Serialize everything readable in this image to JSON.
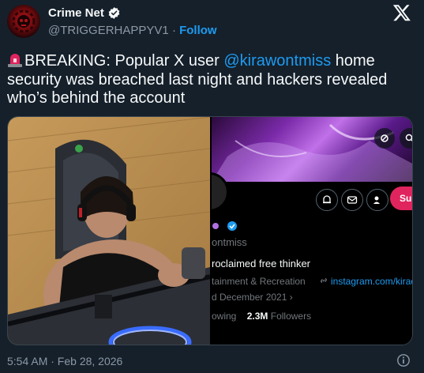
{
  "author": {
    "name": "Crime Net",
    "handle": "@TRIGGERHAPPYV1",
    "separator": "·",
    "follow_label": "Follow"
  },
  "tweet": {
    "text_prefix": "BREAKING: Popular X user ",
    "mention": "@kirawontmiss",
    "text_suffix": " home security was breached last night and hackers revealed who’s behind the account",
    "timestamp": "5:54 AM · Feb 28, 2026"
  },
  "embedded_profile": {
    "handle_partial": "ontmiss",
    "bio_partial": "roclaimed free thinker",
    "category_partial": "tainment & Recreation",
    "link_partial": "instagram.com/kirado",
    "joined_partial": "d December 2021",
    "following_partial": "owing",
    "followers_count": "2.3M",
    "followers_label": "Followers",
    "subscribe_partial": "Sub"
  },
  "colors": {
    "background": "#15202b",
    "accent": "#1d9bf0",
    "subscribe": "#e0245e"
  },
  "icons": [
    "verified-badge-icon",
    "x-logo-icon",
    "police-light-emoji-icon",
    "info-icon",
    "search-icon",
    "notification-icon",
    "message-icon",
    "more-icon"
  ]
}
